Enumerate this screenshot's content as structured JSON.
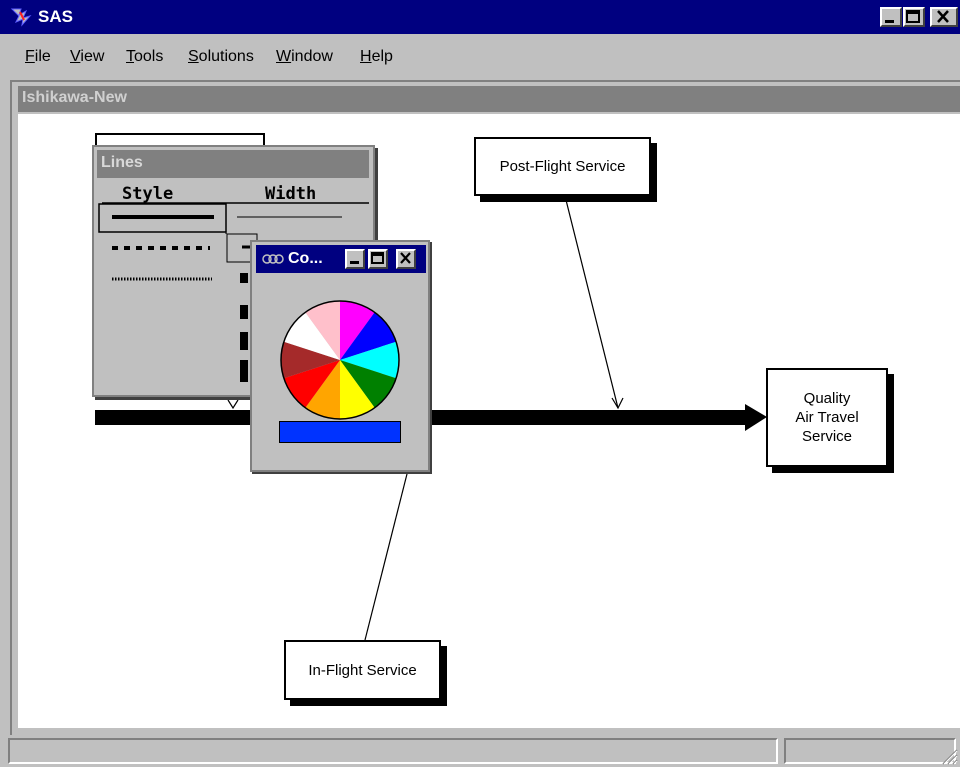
{
  "app": {
    "title": "SAS",
    "icon": "sas-logo-icon"
  },
  "window_controls": {
    "minimize": "_",
    "maximize": "□",
    "close": "✕"
  },
  "menu": [
    {
      "label": "File",
      "accel": "F",
      "rest": "ile"
    },
    {
      "label": "View",
      "accel": "V",
      "rest": "iew"
    },
    {
      "label": "Tools",
      "accel": "T",
      "rest": "ools"
    },
    {
      "label": "Solutions",
      "accel": "S",
      "rest": "olutions"
    },
    {
      "label": "Window",
      "accel": "W",
      "rest": "indow"
    },
    {
      "label": "Help",
      "accel": "H",
      "rest": "elp"
    }
  ],
  "document": {
    "title": "Ishikawa-New"
  },
  "diagram": {
    "effect": "Quality Air Travel Service",
    "effect_lines": [
      "Quality",
      "Air Travel",
      "Service"
    ],
    "causes": {
      "post_flight": "Post-Flight Service",
      "in_flight": "In-Flight Service"
    }
  },
  "lines_palette": {
    "title": "Lines",
    "columns": {
      "style": "Style",
      "width": "Width"
    },
    "styles": [
      "solid",
      "dashed",
      "dotted"
    ],
    "selected_style": "solid"
  },
  "color_palette": {
    "title": "Co...",
    "wheel_colors": [
      "#ff00ff",
      "#0000ff",
      "#00ffff",
      "#008000",
      "#ffff00",
      "#ffa500",
      "#ff0000",
      "#a52a2a",
      "#ffffff",
      "#ffc0cb"
    ],
    "selected_color": "#0033ff"
  },
  "status_bar": {
    "left": "",
    "right": ""
  }
}
